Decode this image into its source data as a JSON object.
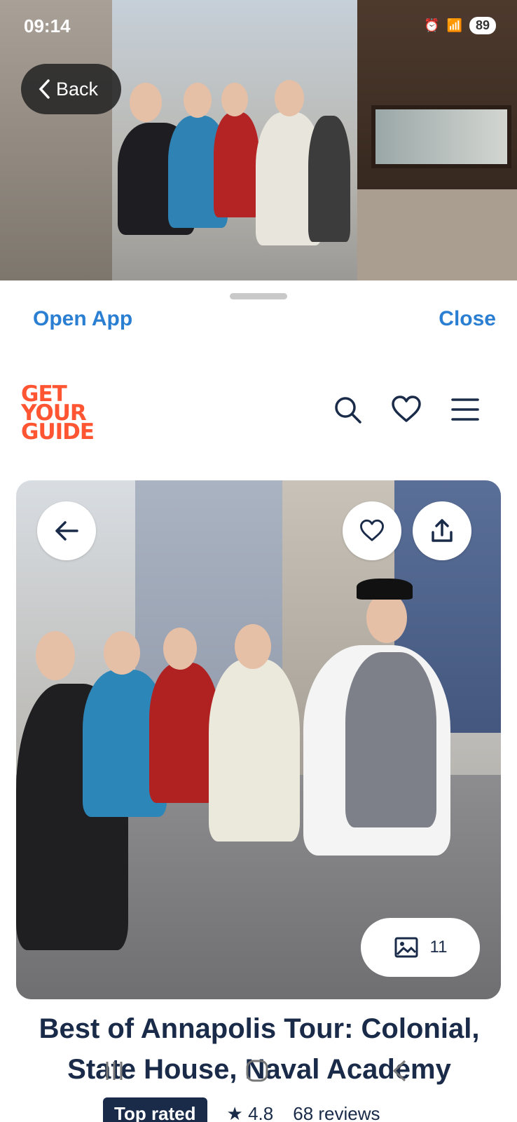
{
  "status_bar": {
    "time": "09:14",
    "battery": "89"
  },
  "overlay": {
    "back_label": "Back"
  },
  "sheet": {
    "open_app": "Open App",
    "close": "Close"
  },
  "brand": {
    "logo_line1": "GET",
    "logo_line2": "YOUR",
    "logo_line3": "GUIDE",
    "logo_color": "#FF5533"
  },
  "header_icons": [
    "search-icon",
    "heart-icon",
    "menu-icon"
  ],
  "hero": {
    "photo_count": "11"
  },
  "tour": {
    "title": "Best of Annapolis Tour: Colonial, State House, Naval Academy",
    "badge": "Top rated",
    "rating": "4.8",
    "reviews": "68 reviews"
  },
  "colors": {
    "link_blue": "#2B7FD3",
    "navy": "#1A2B49"
  }
}
